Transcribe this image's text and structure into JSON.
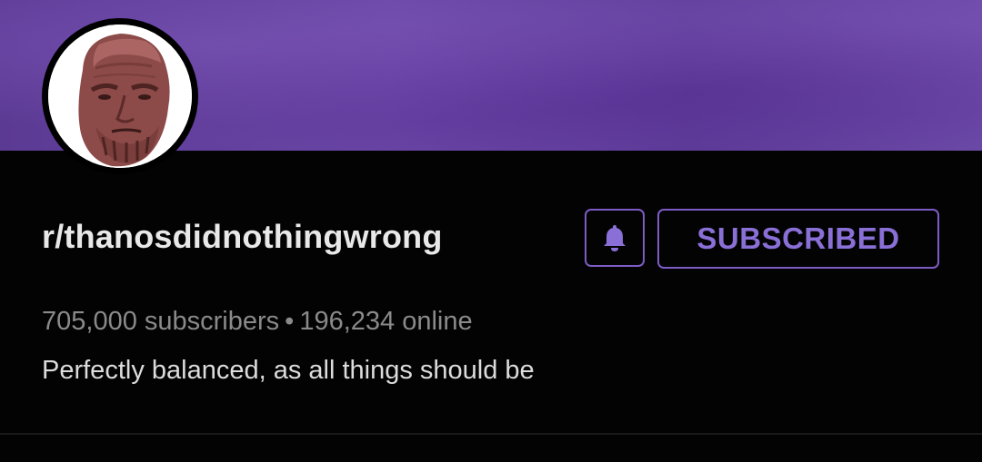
{
  "header": {
    "avatar_icon": "thanos-face-icon",
    "subreddit_name": "r/thanosdidnothingwrong"
  },
  "actions": {
    "bell_icon": "bell-icon",
    "subscribe_label": "SUBSCRIBED",
    "accent_color": "#7c5cc4"
  },
  "stats": {
    "subscribers": "705,000 subscribers",
    "separator": "•",
    "online": "196,234 online"
  },
  "description": "Perfectly balanced, as all things should be",
  "colors": {
    "banner": "#6a47a6",
    "background": "#030303"
  }
}
